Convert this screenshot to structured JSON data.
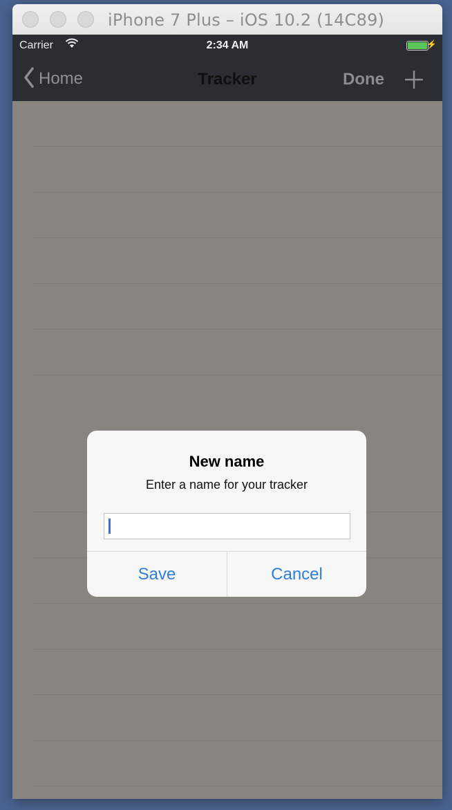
{
  "window": {
    "title": "iPhone 7 Plus – iOS 10.2 (14C89)"
  },
  "status_bar": {
    "carrier": "Carrier",
    "time": "2:34 AM",
    "battery_icon": "battery-full-icon",
    "wifi_icon": "wifi-icon"
  },
  "nav": {
    "back_label": "Home",
    "title": "Tracker",
    "done_label": "Done",
    "add_icon": "plus-icon"
  },
  "alert": {
    "title": "New name",
    "message": "Enter a name for your tracker",
    "input_value": "",
    "save_label": "Save",
    "cancel_label": "Cancel"
  },
  "colors": {
    "tint": "#2f7de1",
    "nav_background": "#2a2d31",
    "dimmed_content": "#888480"
  }
}
